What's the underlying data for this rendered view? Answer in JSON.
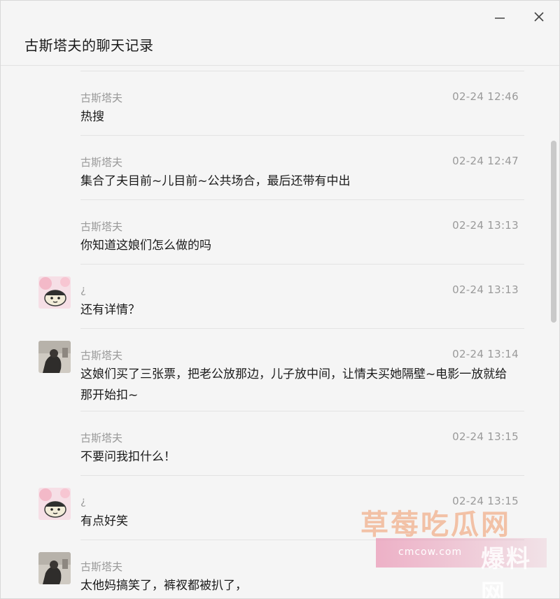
{
  "window": {
    "title": "古斯塔夫的聊天记录"
  },
  "messages": [
    {
      "sender": "古斯塔夫",
      "time": "02-24 12:46",
      "text": "热搜",
      "avatar": "none"
    },
    {
      "sender": "古斯塔夫",
      "time": "02-24 12:47",
      "text": "集合了夫目前~儿目前~公共场合，最后还带有中出",
      "avatar": "none"
    },
    {
      "sender": "古斯塔夫",
      "time": "02-24 13:13",
      "text": "你知道这娘们怎么做的吗",
      "avatar": "none"
    },
    {
      "sender": "¿",
      "time": "02-24 13:13",
      "text": "还有详情？",
      "avatar": "cartoon-avatar"
    },
    {
      "sender": "古斯塔夫",
      "time": "02-24 13:14",
      "text": "这娘们买了三张票，把老公放那边，儿子放中间，让情夫买她隔壁~电影一放就给那开始扣~",
      "avatar": "photo-avatar"
    },
    {
      "sender": "古斯塔夫",
      "time": "02-24 13:15",
      "text": "不要问我扣什么！",
      "avatar": "none"
    },
    {
      "sender": "¿",
      "time": "02-24 13:15",
      "text": "有点好笑",
      "avatar": "cartoon-avatar"
    },
    {
      "sender": "古斯塔夫",
      "time": "",
      "text": "太他妈搞笑了，裤衩都被扒了，",
      "avatar": "photo-avatar"
    }
  ],
  "watermark": {
    "line1": "草莓吃瓜网",
    "line2_url": "cmcow.com",
    "line2_text": "爆料网"
  },
  "colors": {
    "background": "#f5f5f5",
    "meta_text": "#9a9a9a",
    "body_text": "#1a1a1a",
    "divider": "#e3e3e3"
  }
}
